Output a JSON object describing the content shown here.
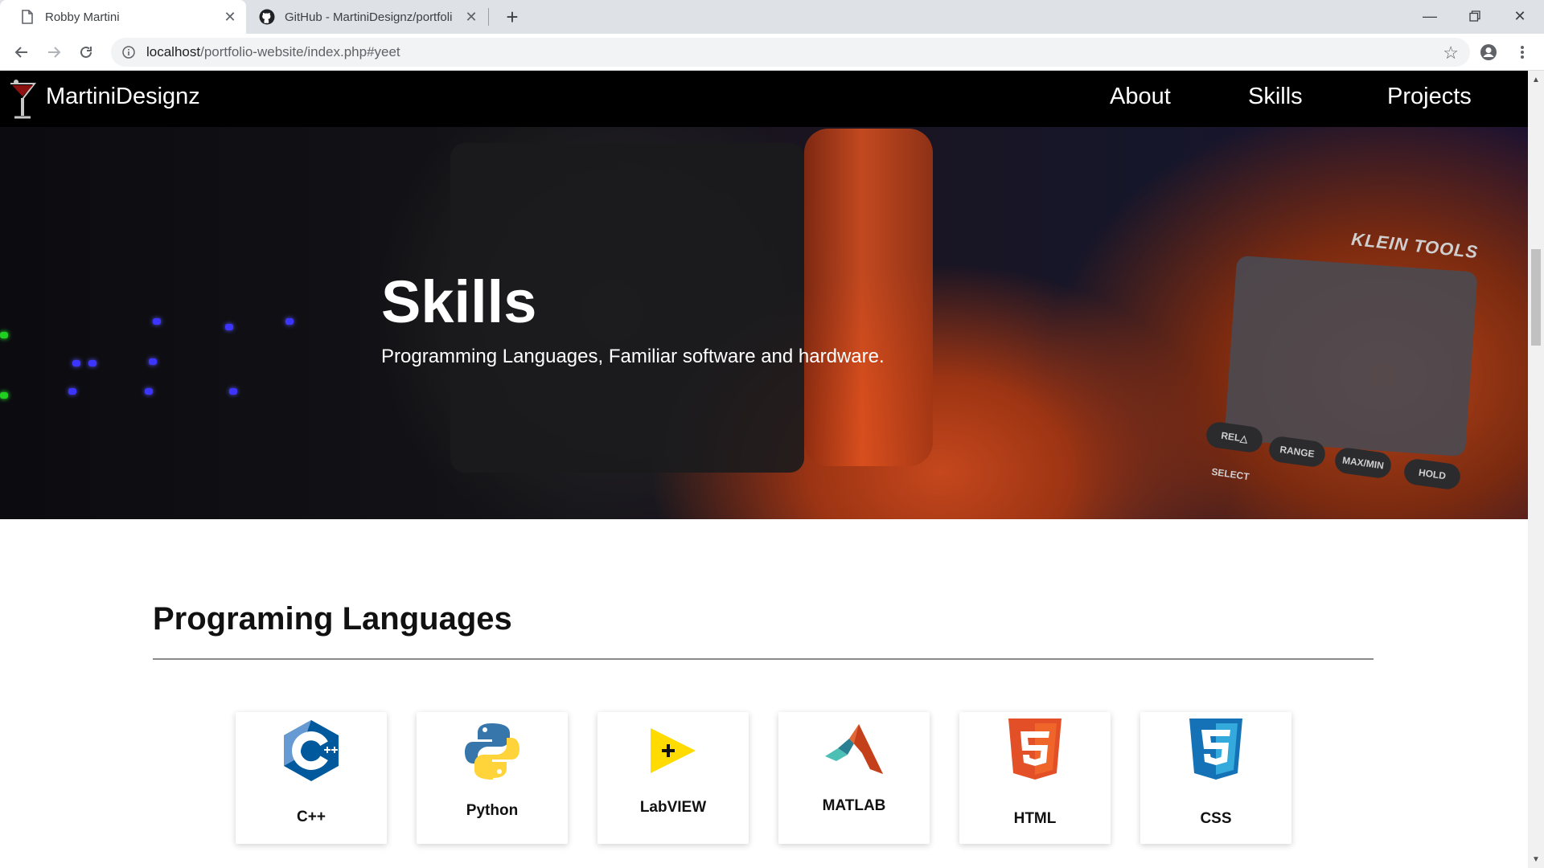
{
  "browser": {
    "tabs": [
      {
        "title": "Robby Martini",
        "active": true
      },
      {
        "title": "GitHub - MartiniDesignz/portfoli",
        "active": false
      }
    ],
    "url_host": "localhost",
    "url_path": "/portfolio-website/index.php#yeet",
    "new_tab_icon": "plus-icon",
    "colors": {
      "tabstrip": "#dee1e6",
      "omnibox": "#f1f3f4"
    }
  },
  "nav": {
    "brand": "MartiniDesignz",
    "links": [
      "About",
      "Skills",
      "Projects"
    ]
  },
  "hero": {
    "title": "Skills",
    "subtitle": "Programming Languages, Familiar software and hardware.",
    "meter_brand": "KLEIN TOOLS",
    "meter_keys": [
      "REL△",
      "RANGE",
      "MAX/MIN",
      "HOLD",
      "SELECT"
    ]
  },
  "section": {
    "heading": "Programing Languages",
    "skills": [
      {
        "label": "C++",
        "icon": "cpp-logo-icon",
        "color": "#00599c"
      },
      {
        "label": "Python",
        "icon": "python-logo-icon",
        "color": "#3776ab"
      },
      {
        "label": "LabVIEW",
        "icon": "labview-logo-icon",
        "color": "#ffdb00"
      },
      {
        "label": "MATLAB",
        "icon": "matlab-logo-icon",
        "color": "#e16737"
      },
      {
        "label": "HTML",
        "icon": "html5-logo-icon",
        "color": "#e34f26"
      },
      {
        "label": "CSS",
        "icon": "css3-logo-icon",
        "color": "#1572b6"
      }
    ]
  }
}
